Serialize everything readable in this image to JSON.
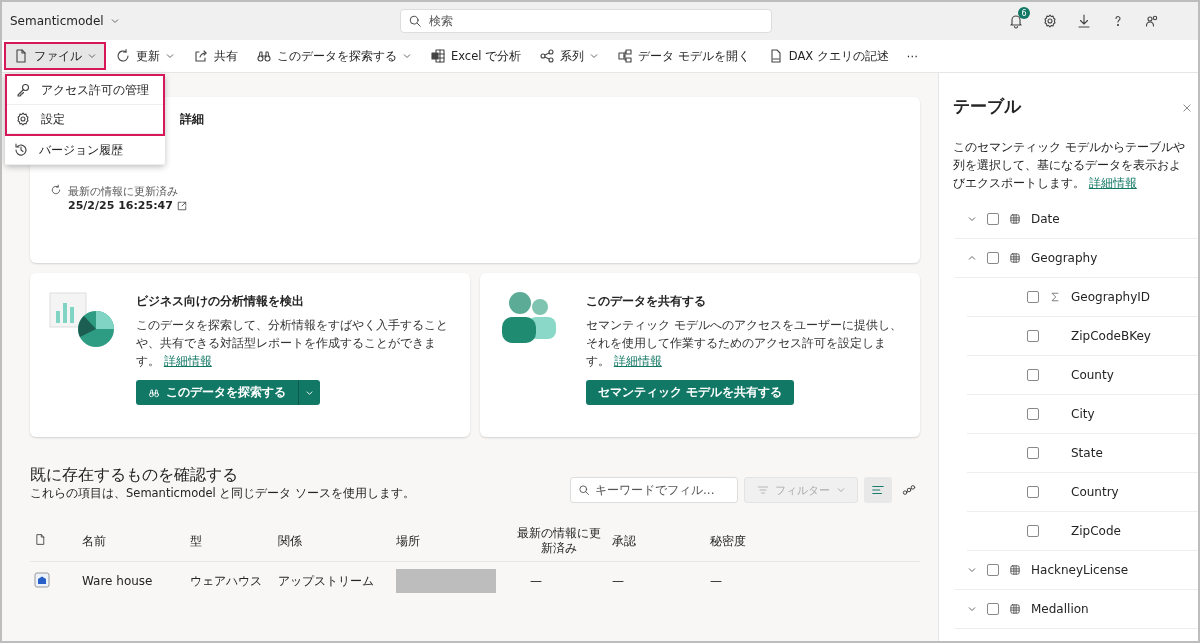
{
  "topbar": {
    "workspace": "Semanticmodel",
    "search": {
      "placeholder": "検索"
    },
    "notifications": "6"
  },
  "toolbar": [
    {
      "label": "ファイル",
      "dropdown": true,
      "selected": true,
      "highlighted": true
    },
    {
      "label": "更新",
      "dropdown": true,
      "selected": false,
      "highlighted": false
    },
    {
      "label": "共有",
      "dropdown": false,
      "selected": false,
      "highlighted": false
    },
    {
      "label": "このデータを探索する",
      "dropdown": true,
      "selected": false,
      "highlighted": false
    },
    {
      "label": "Excel で分析",
      "dropdown": false,
      "selected": false,
      "highlighted": false
    },
    {
      "label": "系列",
      "dropdown": true,
      "selected": false,
      "highlighted": false
    },
    {
      "label": "データ モデルを開く",
      "dropdown": false,
      "selected": false,
      "highlighted": false
    },
    {
      "label": "DAX クエリの記述",
      "dropdown": false,
      "selected": false,
      "highlighted": false
    },
    {
      "label": "⋯",
      "dropdown": false,
      "selected": false,
      "highlighted": false
    }
  ],
  "file_menu": [
    {
      "label": "アクセス許可の管理",
      "highlighted": true
    },
    {
      "label": "設定",
      "highlighted": true
    },
    {
      "label": "バージョン履歴",
      "highlighted": false
    }
  ],
  "details_card": {
    "title": "詳細",
    "refresh_label": "最新の情報に更新済み",
    "refresh_time": "25/2/25 16:25:47"
  },
  "action_cards": [
    {
      "title": "ビジネス向けの分析情報を検出",
      "text": "このデータを探索して、分析情報をすばやく入手することや、共有できる対話型レポートを作成することができます。",
      "link": "詳細情報",
      "button": "このデータを探索する",
      "split": true
    },
    {
      "title": "このデータを共有する",
      "text": "セマンティック モデルへのアクセスをユーザーに提供し、それを使用して作業するためのアクセス許可を設定します。",
      "link": "詳細情報",
      "button": "セマンティック モデルを共有する",
      "split": false
    }
  ],
  "related": {
    "title": "既に存在するものを確認する",
    "subtitle": "これらの項目は、Semanticmodel と同じデータ ソースを使用します。",
    "filter_placeholder": "キーワードでフィル...",
    "filter_button": "フィルター",
    "columns": [
      "名前",
      "型",
      "関係",
      "場所",
      "最新の情報に更新済み",
      "承認",
      "秘密度"
    ],
    "rows": [
      {
        "name": "Ware house",
        "type": "ウェアハウス",
        "relation": "アップストリーム",
        "location_redacted": true,
        "refreshed": "—",
        "endorsement": "—",
        "sensitivity": "—"
      }
    ]
  },
  "tables_panel": {
    "title": "テーブル",
    "text": "このセマンティック モデルからテーブルや列を選択して、基になるデータを表示およびエクスポートします。",
    "link": "詳細情報",
    "tables": [
      {
        "name": "Date",
        "expanded": false,
        "checked": false
      },
      {
        "name": "Geography",
        "expanded": true,
        "checked": false,
        "children": [
          {
            "name": "GeographyID",
            "kind": "measure",
            "checked": false
          },
          {
            "name": "ZipCodeBKey",
            "kind": "column",
            "checked": false
          },
          {
            "name": "County",
            "kind": "column",
            "checked": false
          },
          {
            "name": "City",
            "kind": "column",
            "checked": false
          },
          {
            "name": "State",
            "kind": "column",
            "checked": false
          },
          {
            "name": "Country",
            "kind": "column",
            "checked": false
          },
          {
            "name": "ZipCode",
            "kind": "column",
            "checked": false
          }
        ]
      },
      {
        "name": "HackneyLicense",
        "expanded": false,
        "checked": false
      },
      {
        "name": "Medallion",
        "expanded": false,
        "checked": false
      }
    ]
  }
}
